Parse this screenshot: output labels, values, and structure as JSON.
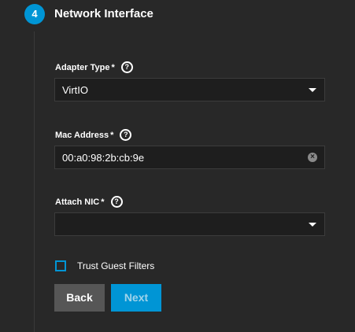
{
  "step": {
    "number": "4",
    "title": "Network Interface"
  },
  "fields": {
    "adapter_type": {
      "label": "Adapter Type",
      "required": "*",
      "value": "VirtIO"
    },
    "mac_address": {
      "label": "Mac Address",
      "required": "*",
      "value": "00:a0:98:2b:cb:9e"
    },
    "attach_nic": {
      "label": "Attach NIC",
      "required": "*",
      "value": ""
    }
  },
  "trust_guest_filters": {
    "label": "Trust Guest Filters",
    "checked": false
  },
  "buttons": {
    "back": "Back",
    "next": "Next"
  },
  "colors": {
    "accent": "#0095d5",
    "background": "#282828",
    "input_background": "#1e1e1e"
  },
  "icons": {
    "help": "help-circle-icon",
    "clear": "clear-icon",
    "dropdown": "caret-down-icon"
  }
}
